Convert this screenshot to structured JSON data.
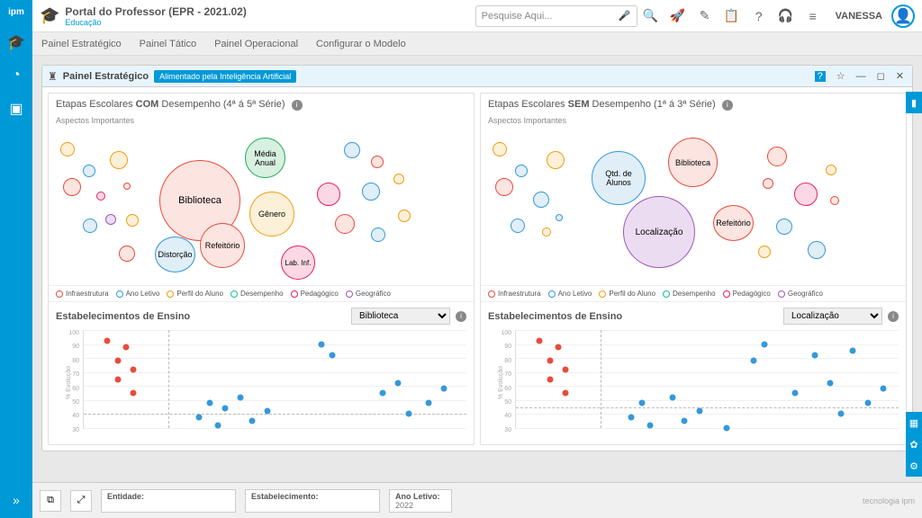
{
  "app": {
    "title": "Portal do Professor (EPR - 2021.02)",
    "subtitle": "Educação",
    "search_placeholder": "Pesquise Aqui...",
    "user": "VANESSA"
  },
  "tabs": [
    "Painel Estratégico",
    "Painel Tático",
    "Painel Operacional",
    "Configurar o Modelo"
  ],
  "panel": {
    "title": "Painel Estratégico",
    "badge": "Alimentado pela Inteligência Artificial"
  },
  "left": {
    "title_prefix": "Etapas Escolares ",
    "title_bold": "COM",
    "title_suffix": " Desempenho (4ª á 5ª Série)",
    "aspects": "Aspectos Importantes",
    "sub_title": "Estabelecimentos de Ensino",
    "select": "Biblioteca"
  },
  "right": {
    "title_prefix": "Etapas Escolares ",
    "title_bold": "SEM",
    "title_suffix": " Desempenho (1ª á 3ª Série)",
    "aspects": "Aspectos Importantes",
    "sub_title": "Estabelecimentos de Ensino",
    "select": "Localização"
  },
  "legend": {
    "infra": "Infraestrutura",
    "ano": "Ano Letivo",
    "perfil": "Perfil do Aluno",
    "desemp": "Desempenho",
    "pedag": "Pedagógico",
    "geo": "Geográfico"
  },
  "bubbles_left": {
    "biblioteca": "Biblioteca",
    "media": "Média Anual",
    "genero": "Gênero",
    "refeitorio": "Refeitório",
    "distorcao": "Distorção",
    "lab": "Lab. Inf."
  },
  "bubbles_right": {
    "qtd": "Qtd. de Alunos",
    "biblioteca": "Biblioteca",
    "localizacao": "Localização",
    "refeitorio": "Refeitório"
  },
  "bottom": {
    "entidade": "Entidade:",
    "estabelecimento": "Estabelecimento:",
    "ano_letivo": "Ano Letivo:",
    "ano_value": "2022",
    "brand": "tecnologia ipm"
  },
  "scatter": {
    "ylabel": "% Evolução",
    "ticks": [
      "100",
      "90",
      "80",
      "70",
      "60",
      "50",
      "40",
      "30"
    ]
  },
  "chart_data": [
    {
      "type": "bubble",
      "title": "Etapas Escolares COM Desempenho (4ª á 5ª Série) — Aspectos Importantes",
      "legend": [
        "Infraestrutura",
        "Ano Letivo",
        "Perfil do Aluno",
        "Desempenho",
        "Pedagógico",
        "Geográfico"
      ],
      "series": [
        {
          "name": "Biblioteca",
          "category": "Infraestrutura",
          "size": 90
        },
        {
          "name": "Média Anual",
          "category": "Desempenho",
          "size": 45
        },
        {
          "name": "Gênero",
          "category": "Perfil do Aluno",
          "size": 50
        },
        {
          "name": "Refeitório",
          "category": "Infraestrutura",
          "size": 50
        },
        {
          "name": "Distorção",
          "category": "Ano Letivo",
          "size": 40
        },
        {
          "name": "Lab. Inf.",
          "category": "Infraestrutura",
          "size": 35
        }
      ]
    },
    {
      "type": "bubble",
      "title": "Etapas Escolares SEM Desempenho (1ª á 3ª Série) — Aspectos Importantes",
      "legend": [
        "Infraestrutura",
        "Ano Letivo",
        "Perfil do Aluno",
        "Desempenho",
        "Pedagógico",
        "Geográfico"
      ],
      "series": [
        {
          "name": "Qtd. de Alunos",
          "category": "Ano Letivo",
          "size": 60
        },
        {
          "name": "Biblioteca",
          "category": "Infraestrutura",
          "size": 55
        },
        {
          "name": "Localização",
          "category": "Geográfico",
          "size": 80
        },
        {
          "name": "Refeitório",
          "category": "Infraestrutura",
          "size": 40
        }
      ]
    },
    {
      "type": "scatter",
      "title": "Estabelecimentos de Ensino — Biblioteca",
      "ylabel": "% Evolução",
      "ylim": [
        30,
        100
      ],
      "ref_y": 40,
      "series": [
        {
          "name": "abaixo",
          "color": "#e74c3c",
          "points": [
            [
              6,
              92
            ],
            [
              9,
              78
            ],
            [
              11,
              88
            ],
            [
              9,
              65
            ],
            [
              13,
              72
            ],
            [
              13,
              55
            ]
          ]
        },
        {
          "name": "acima",
          "color": "#3498db",
          "points": [
            [
              30,
              38
            ],
            [
              33,
              48
            ],
            [
              35,
              32
            ],
            [
              37,
              44
            ],
            [
              41,
              52
            ],
            [
              44,
              35
            ],
            [
              48,
              42
            ],
            [
              62,
              90
            ],
            [
              65,
              82
            ],
            [
              78,
              55
            ],
            [
              82,
              62
            ],
            [
              85,
              40
            ],
            [
              90,
              48
            ],
            [
              94,
              58
            ]
          ]
        }
      ]
    },
    {
      "type": "scatter",
      "title": "Estabelecimentos de Ensino — Localização",
      "ylabel": "% Evolução",
      "ylim": [
        30,
        100
      ],
      "ref_y": 45,
      "series": [
        {
          "name": "abaixo",
          "color": "#e74c3c",
          "points": [
            [
              6,
              92
            ],
            [
              9,
              78
            ],
            [
              11,
              88
            ],
            [
              9,
              65
            ],
            [
              13,
              72
            ],
            [
              13,
              55
            ]
          ]
        },
        {
          "name": "acima",
          "color": "#3498db",
          "points": [
            [
              30,
              38
            ],
            [
              33,
              48
            ],
            [
              35,
              32
            ],
            [
              41,
              52
            ],
            [
              44,
              35
            ],
            [
              48,
              42
            ],
            [
              55,
              30
            ],
            [
              62,
              78
            ],
            [
              65,
              90
            ],
            [
              73,
              55
            ],
            [
              78,
              82
            ],
            [
              82,
              62
            ],
            [
              85,
              40
            ],
            [
              88,
              85
            ],
            [
              92,
              48
            ],
            [
              96,
              58
            ]
          ]
        }
      ]
    }
  ]
}
